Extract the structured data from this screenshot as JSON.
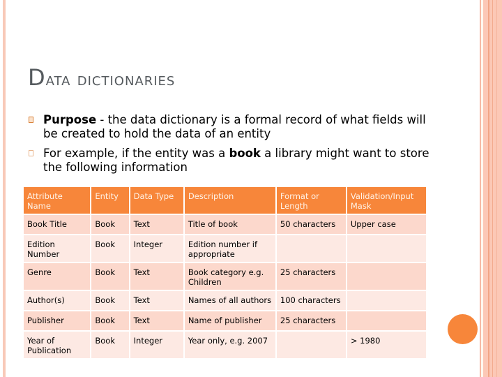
{
  "slide": {
    "title_initial": "D",
    "title_rest": "ata dictionaries",
    "bullets": [
      {
        "bold": "Purpose",
        "text": " - the data dictionary is a formal record of what fields will be created to hold the data of an entity"
      },
      {
        "text_before": "For example, if the entity was a ",
        "bold": "book",
        "text_after": " a library might want to store the following information"
      }
    ],
    "table": {
      "headers": [
        "Attribute Name",
        "Entity",
        "Data Type",
        "Description",
        "Format or Length",
        "Validation/Input Mask"
      ],
      "rows": [
        [
          "Book Title",
          "Book",
          "Text",
          "Title of book",
          "50 characters",
          "Upper case"
        ],
        [
          "Edition Number",
          "Book",
          "Integer",
          "Edition number if appropriate",
          "",
          ""
        ],
        [
          "Genre",
          "Book",
          "Text",
          "Book category e.g. Children",
          "25 characters",
          ""
        ],
        [
          "Author(s)",
          "Book",
          "Text",
          "Names of all authors",
          "100 characters",
          ""
        ],
        [
          "Publisher",
          "Book",
          "Text",
          "Name of publisher",
          "25 characters",
          ""
        ],
        [
          "Year of Publication",
          "Book",
          "Integer",
          "Year only, e.g. 2007",
          "",
          "> 1980"
        ]
      ]
    },
    "colors": {
      "accent": "#f7863a",
      "row_odd": "#fcd8cc",
      "row_even": "#fde9e3",
      "title": "#555a5e",
      "side_band": "#fcc8b6"
    }
  }
}
